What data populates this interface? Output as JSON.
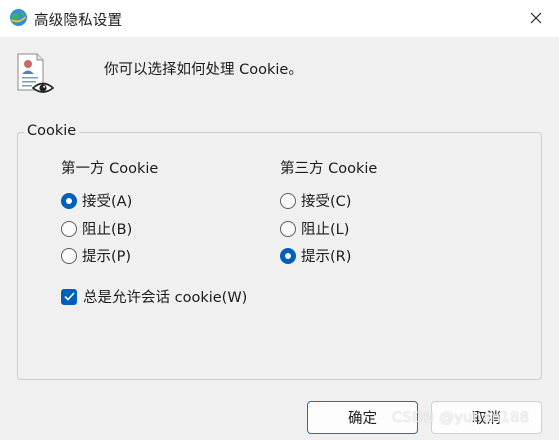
{
  "window": {
    "title": "高级隐私设置",
    "icon": "internet-options-globe-icon",
    "close_icon": "close-icon"
  },
  "intro": {
    "icon": "privacy-document-eye-icon",
    "text": "你可以选择如何处理 Cookie。"
  },
  "cookies_group": {
    "label": "Cookie",
    "first_party": {
      "heading": "第一方 Cookie",
      "options": [
        {
          "label": "接受(A)",
          "checked": true
        },
        {
          "label": "阻止(B)",
          "checked": false
        },
        {
          "label": "提示(P)",
          "checked": false
        }
      ]
    },
    "third_party": {
      "heading": "第三方 Cookie",
      "options": [
        {
          "label": "接受(C)",
          "checked": false
        },
        {
          "label": "阻止(L)",
          "checked": false
        },
        {
          "label": "提示(R)",
          "checked": true
        }
      ]
    },
    "session_cookies": {
      "label": "总是允许会话 cookie(W)",
      "checked": true
    }
  },
  "buttons": {
    "ok_label": "确定",
    "cancel_label": "取消"
  },
  "watermark": "CSDN @yuhan188",
  "colors": {
    "accent": "#005fb8",
    "background": "#f0f0f0",
    "titlebar": "#ffffff"
  }
}
